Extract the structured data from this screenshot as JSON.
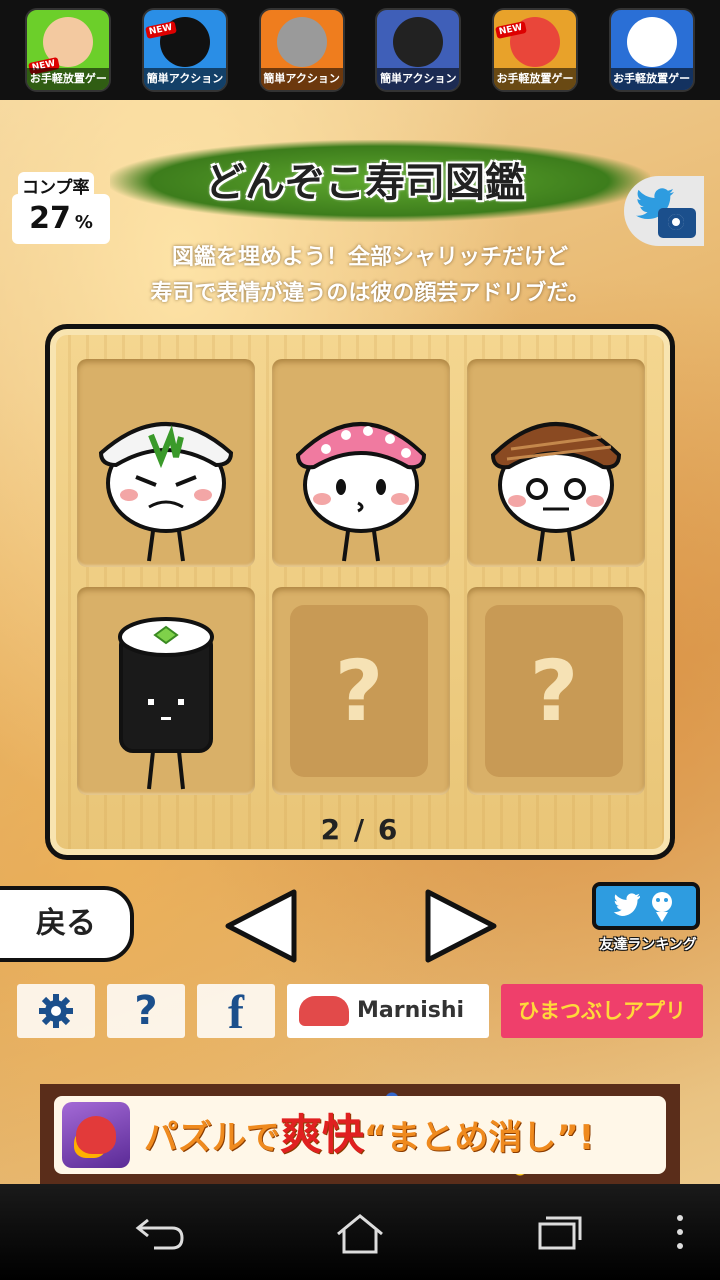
{
  "promo_apps": [
    {
      "caption": "お手軽放置ゲー",
      "badge": "NEW",
      "color": "#6ccf2a"
    },
    {
      "caption": "簡単アクション",
      "badge": "NEW",
      "color": "#2a8ee6"
    },
    {
      "caption": "簡単アクション",
      "badge": "",
      "color": "#ef7d1e"
    },
    {
      "caption": "簡単アクション",
      "badge": "",
      "color": "#3f5fb8"
    },
    {
      "caption": "お手軽放置ゲー",
      "badge": "NEW",
      "color": "#e8a22a"
    },
    {
      "caption": "お手軽放置ゲー",
      "badge": "",
      "color": "#2a6fd6"
    }
  ],
  "header": {
    "title": "どんぞこ寿司図鑑",
    "completion_label": "コンプ率",
    "completion_value": "27",
    "completion_unit": "%"
  },
  "description": {
    "line1": "図鑑を埋めよう！全部シャリッチだけど",
    "line2": "寿司で表情が違うのは彼の顔芸アドリブだ。"
  },
  "collection": {
    "items": [
      {
        "name": "negi-sushi",
        "unlocked": true
      },
      {
        "name": "tako-sushi",
        "unlocked": true
      },
      {
        "name": "anago-sushi",
        "unlocked": true
      },
      {
        "name": "kappa-maki",
        "unlocked": true
      },
      {
        "name": "locked",
        "unlocked": false,
        "label": "?"
      },
      {
        "name": "locked",
        "unlocked": false,
        "label": "?"
      }
    ],
    "page_indicator": "2 / 6"
  },
  "nav": {
    "back_label": "戻る",
    "ranking_label": "友達ランキング"
  },
  "bottom_buttons": {
    "help_label": "?",
    "facebook_label": "f",
    "marnishi_label": "Marnishi",
    "himatsubushi_label": "ひまつぶしアプリ"
  },
  "ad": {
    "text_prefix": "パズルで",
    "text_emphasis": "爽快",
    "text_suffix": "“まとめ消し”!"
  },
  "colors": {
    "accent_green": "#3d7d1c",
    "twitter_blue": "#2e9ce0",
    "himatsubushi_pink": "#ef3f6b"
  }
}
